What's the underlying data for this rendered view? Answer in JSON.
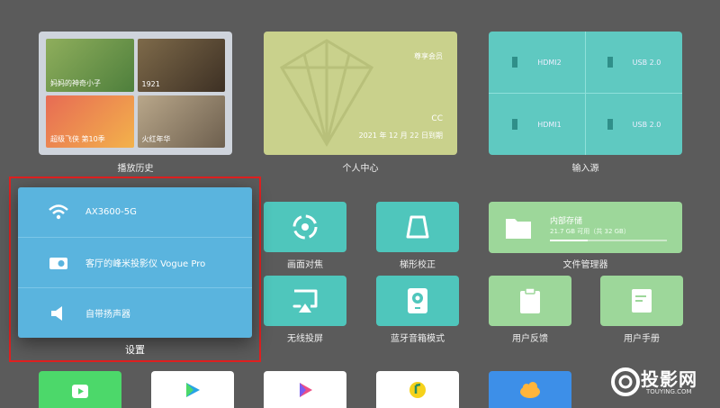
{
  "history": {
    "caption": "播放历史",
    "items": [
      {
        "title": "妈妈的神奇小子"
      },
      {
        "title": "1921"
      },
      {
        "title": "超级飞侠 第10季"
      },
      {
        "title": "火红年华"
      }
    ]
  },
  "member": {
    "caption": "个人中心",
    "badge": "尊享会员",
    "user": "CC",
    "expiry": "2021 年 12 月 22 日到期"
  },
  "inputs": {
    "caption": "输入源",
    "ports": [
      {
        "label": "HDMI2"
      },
      {
        "label": "USB 2.0"
      },
      {
        "label": "HDMI1"
      },
      {
        "label": "USB 2.0"
      }
    ]
  },
  "tiles": {
    "focus": "画面对焦",
    "keystone": "梯形校正",
    "screencast": "无线投屏",
    "bt_speaker": "蓝牙音箱模式",
    "feedback": "用户反馈",
    "manual": "用户手册"
  },
  "storage": {
    "caption": "文件管理器",
    "title": "内部存储",
    "detail": "21.7 GB 可用（共 32 GB）",
    "used_fraction": 0.32
  },
  "settings_popup": {
    "caption": "设置",
    "items": [
      {
        "label": "AX3600-5G",
        "icon": "wifi-icon"
      },
      {
        "label": "客厅的峰米投影仪 Vogue Pro",
        "icon": "projector-icon"
      },
      {
        "label": "自带扬声器",
        "icon": "speaker-icon"
      }
    ]
  },
  "watermark": {
    "brand": "投影网",
    "domain": "TOUYING.COM"
  },
  "colors": {
    "background": "#5b5b5b",
    "teal": "#4fc6bc",
    "green": "#9dd79a",
    "popup": "#5ab4de",
    "highlight": "#e02020"
  }
}
